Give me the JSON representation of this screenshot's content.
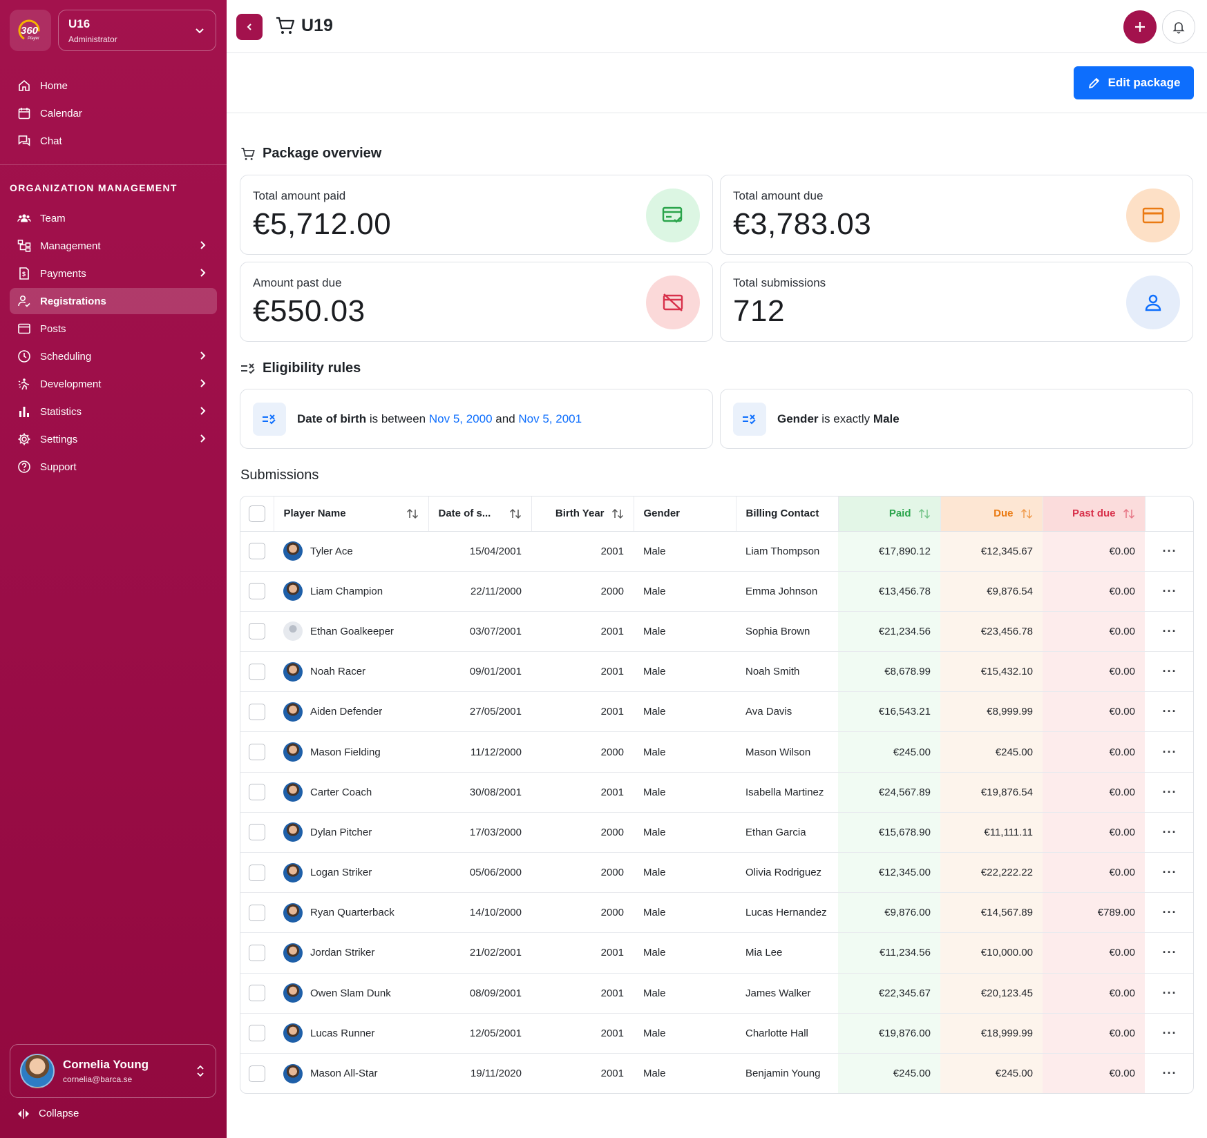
{
  "sidebar": {
    "team": {
      "name": "U16",
      "role": "Administrator"
    },
    "top_items": [
      {
        "label": "Home",
        "icon": "home-icon"
      },
      {
        "label": "Calendar",
        "icon": "calendar-icon"
      },
      {
        "label": "Chat",
        "icon": "chat-icon"
      }
    ],
    "section_title": "ORGANIZATION MANAGEMENT",
    "org_items": [
      {
        "label": "Team",
        "icon": "team-icon",
        "arrow": false
      },
      {
        "label": "Management",
        "icon": "org-chart-icon",
        "arrow": true
      },
      {
        "label": "Payments",
        "icon": "invoice-icon",
        "arrow": true
      },
      {
        "label": "Registrations",
        "icon": "user-check-icon",
        "arrow": false,
        "active": true
      },
      {
        "label": "Posts",
        "icon": "window-icon",
        "arrow": false
      },
      {
        "label": "Scheduling",
        "icon": "clock-icon",
        "arrow": true
      },
      {
        "label": "Development",
        "icon": "growth-icon",
        "arrow": true
      },
      {
        "label": "Statistics",
        "icon": "bar-chart-icon",
        "arrow": true
      },
      {
        "label": "Settings",
        "icon": "gear-icon",
        "arrow": true
      },
      {
        "label": "Support",
        "icon": "help-icon",
        "arrow": false
      }
    ],
    "user": {
      "name": "Cornelia Young",
      "email": "cornelia@barca.se"
    },
    "collapse_label": "Collapse"
  },
  "header": {
    "title": "U19"
  },
  "toolbar": {
    "edit_label": "Edit package"
  },
  "overview": {
    "title": "Package overview",
    "cards": [
      {
        "label": "Total amount paid",
        "value": "€5,712.00",
        "icon": "card-check-icon"
      },
      {
        "label": "Total amount due",
        "value": "€3,783.03",
        "icon": "credit-card-icon"
      },
      {
        "label": "Amount past due",
        "value": "€550.03",
        "icon": "card-off-icon"
      },
      {
        "label": "Total submissions",
        "value": "712",
        "icon": "user-icon"
      }
    ]
  },
  "eligibility": {
    "title": "Eligibility rules",
    "rules": [
      {
        "field": "Date of birth",
        "op1": "is between",
        "v1": "Nov 5, 2000",
        "op2": "and",
        "v2": "Nov 5, 2001"
      },
      {
        "field": "Gender",
        "op1": "is exactly",
        "v1": "Male"
      }
    ]
  },
  "submissions": {
    "title": "Submissions",
    "columns": [
      "Player Name",
      "Date of s...",
      "Birth Year",
      "Gender",
      "Billing Contact",
      "Paid",
      "Due",
      "Past due"
    ],
    "rows": [
      {
        "name": "Tyler Ace",
        "date": "15/04/2001",
        "year": "2001",
        "gender": "Male",
        "contact": "Liam Thompson",
        "paid": "€17,890.12",
        "due": "€12,345.67",
        "past": "€0.00",
        "avatar": "photo"
      },
      {
        "name": "Liam Champion",
        "date": "22/11/2000",
        "year": "2000",
        "gender": "Male",
        "contact": "Emma Johnson",
        "paid": "€13,456.78",
        "due": "€9,876.54",
        "past": "€0.00",
        "avatar": "photo"
      },
      {
        "name": "Ethan Goalkeeper",
        "date": "03/07/2001",
        "year": "2001",
        "gender": "Male",
        "contact": "Sophia Brown",
        "paid": "€21,234.56",
        "due": "€23,456.78",
        "past": "€0.00",
        "avatar": "placeholder"
      },
      {
        "name": "Noah Racer",
        "date": "09/01/2001",
        "year": "2001",
        "gender": "Male",
        "contact": "Noah Smith",
        "paid": "€8,678.99",
        "due": "€15,432.10",
        "past": "€0.00",
        "avatar": "photo"
      },
      {
        "name": "Aiden Defender",
        "date": "27/05/2001",
        "year": "2001",
        "gender": "Male",
        "contact": "Ava Davis",
        "paid": "€16,543.21",
        "due": "€8,999.99",
        "past": "€0.00",
        "avatar": "photo"
      },
      {
        "name": "Mason Fielding",
        "date": "11/12/2000",
        "year": "2000",
        "gender": "Male",
        "contact": "Mason Wilson",
        "paid": "€245.00",
        "due": "€245.00",
        "past": "€0.00",
        "avatar": "photo"
      },
      {
        "name": "Carter Coach",
        "date": "30/08/2001",
        "year": "2001",
        "gender": "Male",
        "contact": "Isabella Martinez",
        "paid": "€24,567.89",
        "due": "€19,876.54",
        "past": "€0.00",
        "avatar": "photo"
      },
      {
        "name": "Dylan Pitcher",
        "date": "17/03/2000",
        "year": "2000",
        "gender": "Male",
        "contact": "Ethan Garcia",
        "paid": "€15,678.90",
        "due": "€11,111.11",
        "past": "€0.00",
        "avatar": "photo"
      },
      {
        "name": "Logan Striker",
        "date": "05/06/2000",
        "year": "2000",
        "gender": "Male",
        "contact": "Olivia Rodriguez",
        "paid": "€12,345.00",
        "due": "€22,222.22",
        "past": "€0.00",
        "avatar": "photo"
      },
      {
        "name": "Ryan Quarterback",
        "date": "14/10/2000",
        "year": "2000",
        "gender": "Male",
        "contact": "Lucas Hernandez",
        "paid": "€9,876.00",
        "due": "€14,567.89",
        "past": "€789.00",
        "avatar": "photo"
      },
      {
        "name": "Jordan Striker",
        "date": "21/02/2001",
        "year": "2001",
        "gender": "Male",
        "contact": "Mia Lee",
        "paid": "€11,234.56",
        "due": "€10,000.00",
        "past": "€0.00",
        "avatar": "photo"
      },
      {
        "name": "Owen Slam Dunk",
        "date": "08/09/2001",
        "year": "2001",
        "gender": "Male",
        "contact": "James Walker",
        "paid": "€22,345.67",
        "due": "€20,123.45",
        "past": "€0.00",
        "avatar": "photo"
      },
      {
        "name": "Lucas Runner",
        "date": "12/05/2001",
        "year": "2001",
        "gender": "Male",
        "contact": "Charlotte Hall",
        "paid": "€19,876.00",
        "due": "€18,999.99",
        "past": "€0.00",
        "avatar": "photo"
      },
      {
        "name": "Mason All-Star",
        "date": "19/11/2020",
        "year": "2001",
        "gender": "Male",
        "contact": "Benjamin Young",
        "paid": "€245.00",
        "due": "€245.00",
        "past": "€0.00",
        "avatar": "photo"
      }
    ]
  },
  "colors": {
    "brand": "#a3124d",
    "accent": "#0d6efd",
    "paid": "#2aa44b",
    "due": "#ea7a12",
    "past_due": "#d8314b"
  }
}
